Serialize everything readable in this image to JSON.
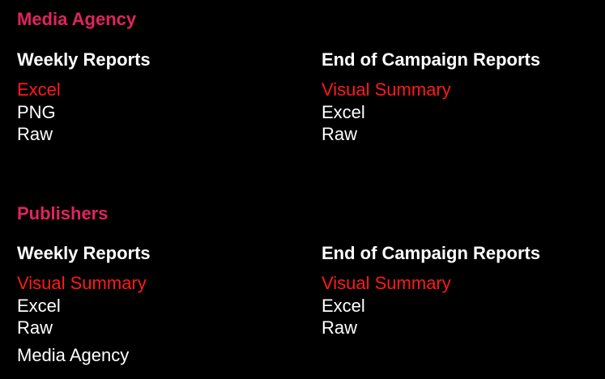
{
  "colors": {
    "background": "#000000",
    "section_title": "#e0245e",
    "active_link": "#ff1a1a",
    "text": "#ffffff"
  },
  "sections": [
    {
      "title": "Media Agency",
      "columns": [
        {
          "heading": "Weekly Reports",
          "items": [
            {
              "label": "Excel",
              "active": true
            },
            {
              "label": "PNG",
              "active": false
            },
            {
              "label": "Raw",
              "active": false
            }
          ]
        },
        {
          "heading": "End of Campaign Reports",
          "items": [
            {
              "label": "Visual Summary",
              "active": true
            },
            {
              "label": "Excel",
              "active": false
            },
            {
              "label": "Raw",
              "active": false
            }
          ]
        }
      ]
    },
    {
      "title": "Publishers",
      "columns": [
        {
          "heading": "Weekly Reports",
          "items": [
            {
              "label": "Visual Summary",
              "active": true
            },
            {
              "label": "Excel",
              "active": false
            },
            {
              "label": "Raw",
              "active": false
            }
          ]
        },
        {
          "heading": "End of Campaign Reports",
          "items": [
            {
              "label": "Visual Summary",
              "active": true
            },
            {
              "label": "Excel",
              "active": false
            },
            {
              "label": "Raw",
              "active": false
            }
          ]
        }
      ]
    }
  ],
  "footer": {
    "label": "Media Agency"
  }
}
